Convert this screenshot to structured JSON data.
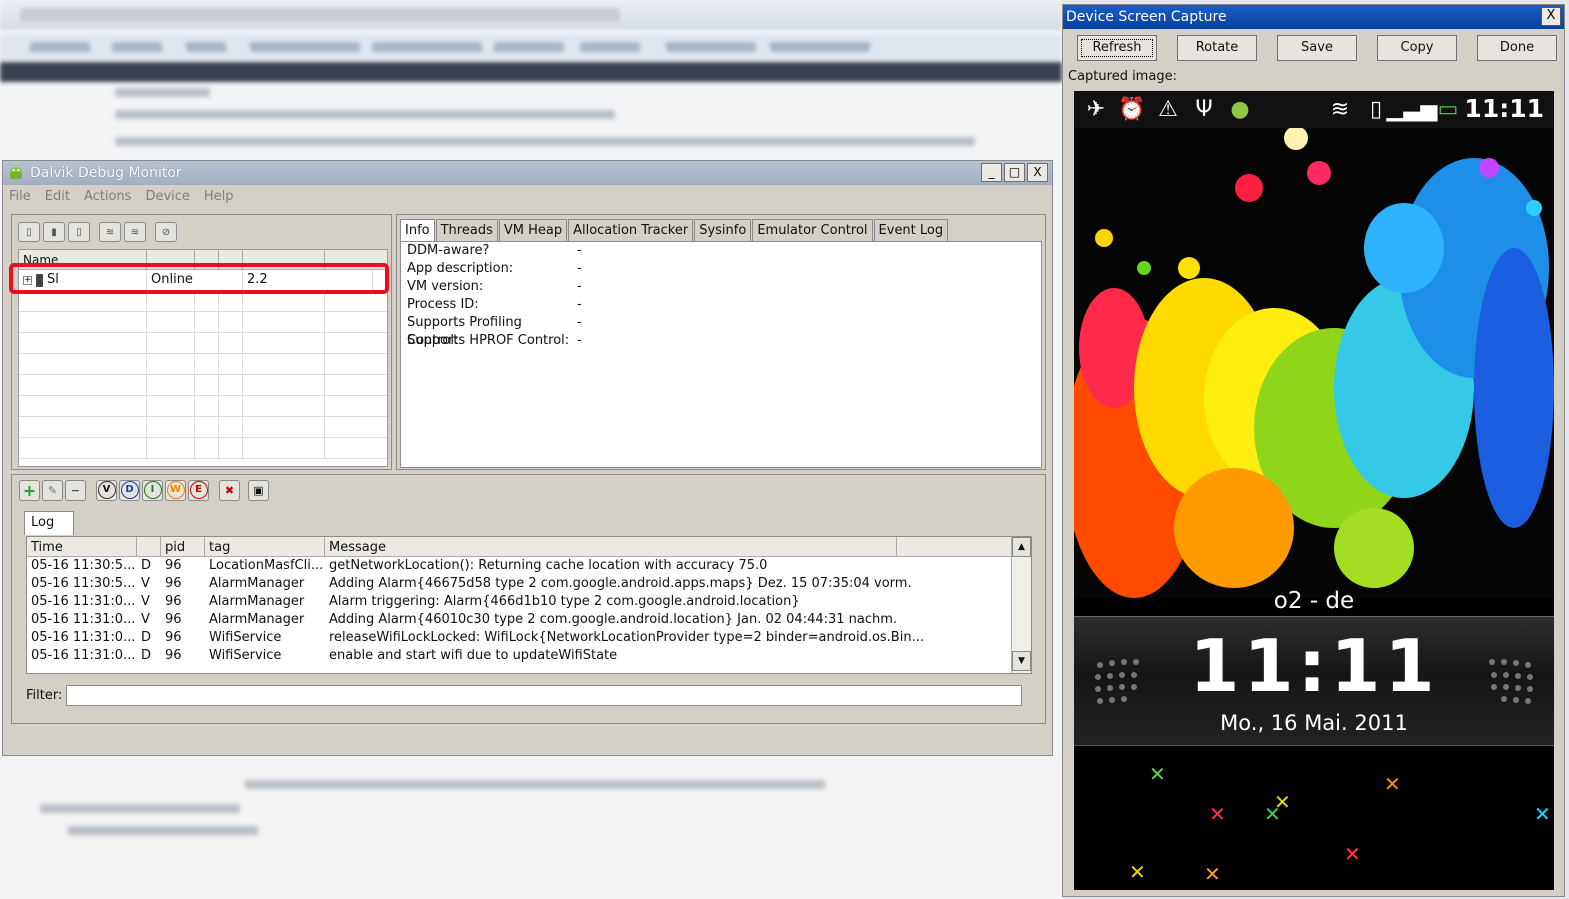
{
  "ddms": {
    "title": "Dalvik Debug Monitor",
    "window_buttons": [
      "_",
      "□",
      "X"
    ],
    "menu": [
      "File",
      "Edit",
      "Actions",
      "Device",
      "Help"
    ],
    "device_table": {
      "header": [
        "Name",
        "",
        "",
        "",
        ""
      ],
      "device": {
        "name": "Sl",
        "status": "Online",
        "version": "2.2"
      }
    },
    "tabs": [
      "Info",
      "Threads",
      "VM Heap",
      "Allocation Tracker",
      "Sysinfo",
      "Emulator Control",
      "Event Log"
    ],
    "info": [
      {
        "key": "DDM-aware?",
        "value": "-"
      },
      {
        "key": "App description:",
        "value": "-"
      },
      {
        "key": "VM version:",
        "value": "-"
      },
      {
        "key": "Process ID:",
        "value": "-"
      },
      {
        "key": "Supports Profiling Control:",
        "value": "-"
      },
      {
        "key": "Supports HPROF Control:",
        "value": "-"
      }
    ],
    "log": {
      "tab": "Log",
      "level_buttons": [
        "V",
        "D",
        "I",
        "W",
        "E"
      ],
      "columns": [
        "Time",
        "",
        "pid",
        "tag",
        "Message"
      ],
      "rows": [
        {
          "time": "05-16 11:30:5...",
          "level": "D",
          "pid": "96",
          "tag": "LocationMasfCli...",
          "message": "getNetworkLocation(): Returning cache location with accuracy 75.0"
        },
        {
          "time": "05-16 11:30:5...",
          "level": "V",
          "pid": "96",
          "tag": "AlarmManager",
          "message": "Adding Alarm{46675d58 type 2 com.google.android.apps.maps} Dez. 15 07:35:04 vorm."
        },
        {
          "time": "05-16 11:31:0...",
          "level": "V",
          "pid": "96",
          "tag": "AlarmManager",
          "message": "Alarm triggering: Alarm{466d1b10 type 2 com.google.android.location}"
        },
        {
          "time": "05-16 11:31:0...",
          "level": "V",
          "pid": "96",
          "tag": "AlarmManager",
          "message": "Adding Alarm{46010c30 type 2 com.google.android.location} Jan. 02 04:44:31 nachm."
        },
        {
          "time": "05-16 11:31:0...",
          "level": "D",
          "pid": "96",
          "tag": "WifiService",
          "message": "releaseWifiLockLocked: WifiLock{NetworkLocationProvider type=2 binder=android.os.Bin..."
        },
        {
          "time": "05-16 11:31:0...",
          "level": "D",
          "pid": "96",
          "tag": "WifiService",
          "message": "enable and start wifi due to updateWifiState"
        }
      ],
      "filter_label": "Filter:",
      "filter_value": ""
    }
  },
  "capture": {
    "title": "Device Screen Capture",
    "close": "X",
    "buttons": [
      "Refresh",
      "Rotate",
      "Save",
      "Copy",
      "Done"
    ],
    "label": "Captured image:",
    "phone": {
      "status_time": "11:11",
      "status_icons": [
        "airplane-icon",
        "alarm-icon",
        "warning-icon",
        "usb-icon",
        "android-debug-icon",
        "wifi-icon",
        "vibrate-icon",
        "signal-icon",
        "battery-icon"
      ],
      "carrier": "o2 - de",
      "clock": "11:11",
      "date": "Mo., 16 Mai. 2011"
    }
  },
  "colors": {
    "highlight": "#e8101b",
    "capture_title": "#0a3f9c"
  }
}
